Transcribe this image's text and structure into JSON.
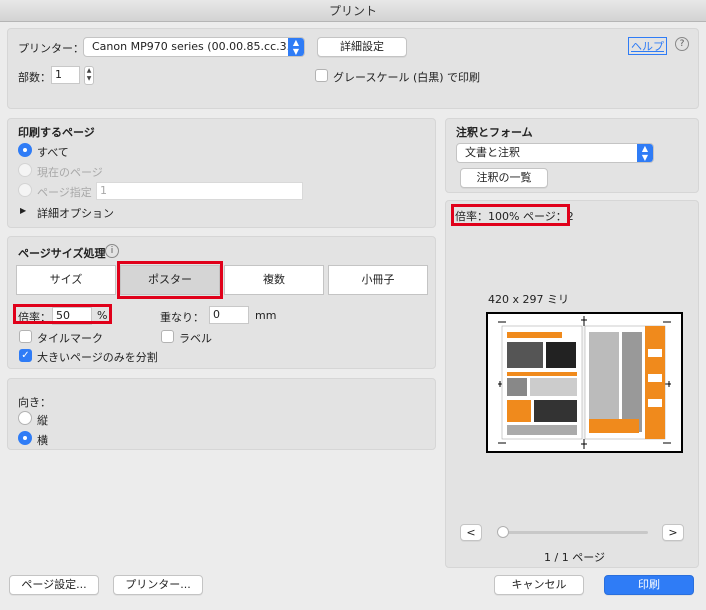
{
  "window": {
    "title": "プリント"
  },
  "printer": {
    "label": "プリンター：",
    "selected": "Canon MP970 series (00.00.85.cc.3...",
    "details_button": "詳細設定",
    "help_link": "ヘルプ",
    "help_icon": "?"
  },
  "copies": {
    "label": "部数：",
    "value": "1"
  },
  "grayscale": {
    "label": "グレースケール (白黒) で印刷",
    "checked": false
  },
  "pages": {
    "title": "印刷するページ",
    "all": "すべて",
    "current": "現在のページ",
    "range": "ページ指定",
    "range_value": "1",
    "advanced": "詳細オプション"
  },
  "page_size": {
    "title": "ページサイズ処理",
    "info_icon": "i",
    "tabs": [
      "サイズ",
      "ポスター",
      "複数",
      "小冊子"
    ],
    "selected_tab": "ポスター",
    "scale_label": "倍率：",
    "scale_value": "50",
    "scale_unit": "%",
    "overlap_label": "重なり：",
    "overlap_value": "0",
    "overlap_unit": "mm",
    "tile_marks": "タイルマーク",
    "labels": "ラベル",
    "split_large": "大きいページのみを分割"
  },
  "orientation": {
    "title": "向き：",
    "portrait": "縦",
    "landscape": "横",
    "selected": "横"
  },
  "annotations": {
    "title": "注釈とフォーム",
    "selected": "文書と注釈",
    "list_button": "注釈の一覧"
  },
  "preview": {
    "info": "倍率：100% ページ：2",
    "paper_size": "420 x 297 ミリ",
    "prev": "<",
    "next": ">",
    "page_count": "1 / 1 ページ"
  },
  "footer": {
    "page_setup": "ページ設定...",
    "printer": "プリンター...",
    "cancel": "キャンセル",
    "print": "印刷"
  },
  "colors": {
    "accent": "#2f7cf6",
    "highlight": "#e0001a",
    "orange": "#f08a1c"
  }
}
